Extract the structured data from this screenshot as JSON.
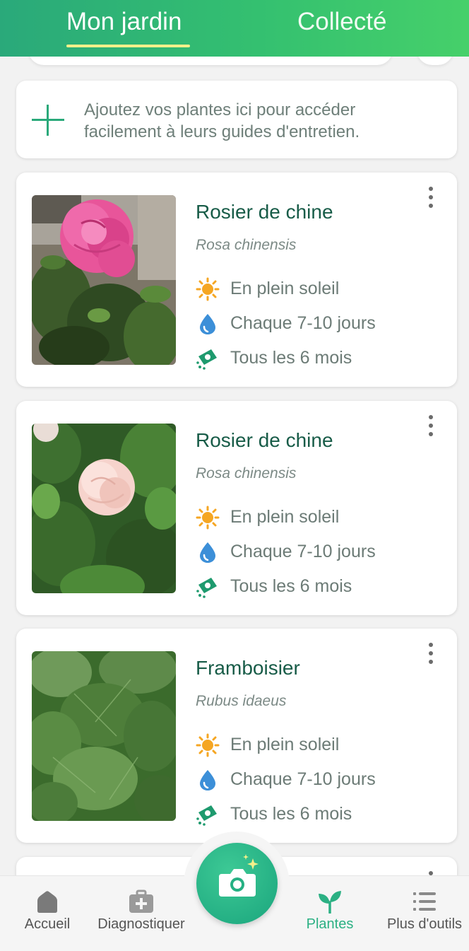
{
  "header": {
    "tabs": [
      {
        "label": "Mon jardin",
        "active": true
      },
      {
        "label": "Collecté",
        "active": false
      }
    ],
    "accent": "#2aa97a",
    "underline_color": "#f3f08a"
  },
  "add_card": {
    "text": "Ajoutez vos plantes ici pour accéder facilement à leurs guides d'entretien.",
    "icon": "plus-icon"
  },
  "plants": [
    {
      "name": "Rosier de chine",
      "scientific": "Rosa chinensis",
      "sunlight": "En plein soleil",
      "watering": "Chaque 7-10 jours",
      "fertilizing": "Tous les 6 mois",
      "photo": "pink-rose-photo"
    },
    {
      "name": "Rosier de chine",
      "scientific": "Rosa chinensis",
      "sunlight": "En plein soleil",
      "watering": "Chaque 7-10 jours",
      "fertilizing": "Tous les 6 mois",
      "photo": "pale-rose-photo"
    },
    {
      "name": "Framboisier",
      "scientific": "Rubus idaeus",
      "sunlight": "En plein soleil",
      "watering": "Chaque 7-10 jours",
      "fertilizing": "Tous les 6 mois",
      "photo": "raspberry-leaves-photo"
    }
  ],
  "bottom_nav": {
    "items": [
      {
        "label": "Accueil",
        "icon": "home-icon",
        "active": false
      },
      {
        "label": "Diagnostiquer",
        "icon": "first-aid-kit-icon",
        "active": false
      },
      {
        "label": "Plantes",
        "icon": "sprout-icon",
        "active": true
      },
      {
        "label": "Plus d'outils",
        "icon": "list-icon",
        "active": false
      }
    ],
    "camera": "camera-icon",
    "active_color": "#2bb083"
  }
}
